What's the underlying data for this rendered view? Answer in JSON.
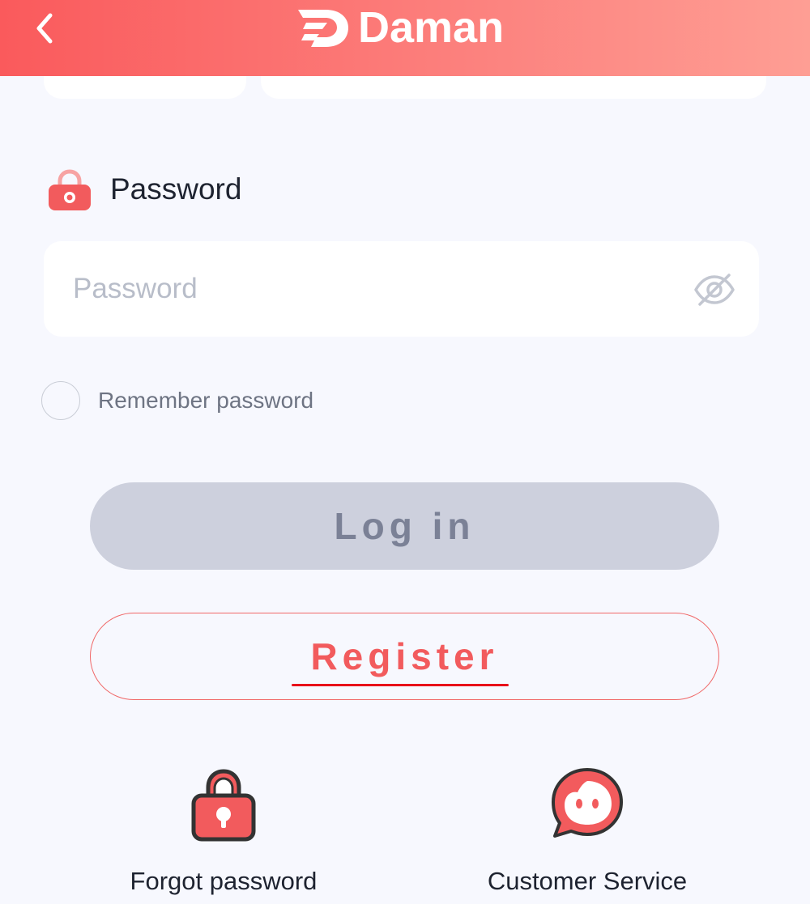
{
  "header": {
    "brand": "Daman",
    "back_icon": "chevron-left-icon",
    "logo_icon": "daman-logo-icon"
  },
  "password_section": {
    "label": "Password",
    "label_icon": "lock-icon",
    "input_value": "",
    "input_placeholder": "Password",
    "toggle_icon": "eye-off-icon"
  },
  "remember": {
    "label": "Remember password",
    "checked": false
  },
  "buttons": {
    "login_label": "Log in",
    "register_label": "Register"
  },
  "bottom_links": {
    "forgot_label": "Forgot password",
    "forgot_icon": "lock-icon",
    "service_label": "Customer Service",
    "service_icon": "chat-bubble-icon"
  },
  "colors": {
    "accent": "#f25b5d",
    "header_gradient_start": "#fa5a5c",
    "header_gradient_end": "#fe9e94",
    "login_disabled_bg": "#cdd0dd",
    "background": "#f7f8fe"
  }
}
